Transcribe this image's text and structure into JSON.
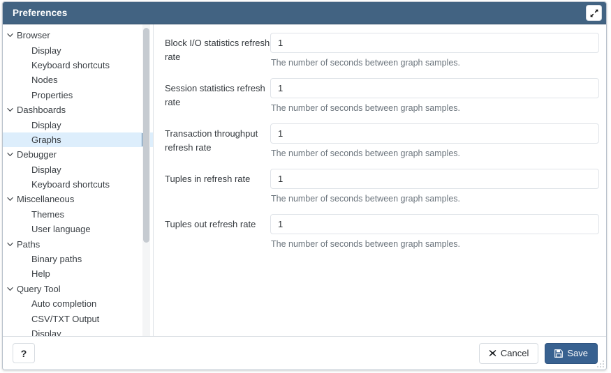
{
  "window": {
    "title": "Preferences",
    "maximize_icon": "expand-diagonal-icon",
    "accent_color": "#426382",
    "selected_row_bg": "#ddeefc",
    "selected_row_marker": "#2c5f8f"
  },
  "sidebar": {
    "items": [
      {
        "label": "Browser",
        "level": "group",
        "expanded": true,
        "icon": "chevron-down-icon",
        "selected": false
      },
      {
        "label": "Display",
        "level": "child",
        "expanded": null,
        "icon": "",
        "selected": false
      },
      {
        "label": "Keyboard shortcuts",
        "level": "child",
        "expanded": null,
        "icon": "",
        "selected": false
      },
      {
        "label": "Nodes",
        "level": "child",
        "expanded": null,
        "icon": "",
        "selected": false
      },
      {
        "label": "Properties",
        "level": "child",
        "expanded": null,
        "icon": "",
        "selected": false
      },
      {
        "label": "Dashboards",
        "level": "group",
        "expanded": true,
        "icon": "chevron-down-icon",
        "selected": false
      },
      {
        "label": "Display",
        "level": "child",
        "expanded": null,
        "icon": "",
        "selected": false
      },
      {
        "label": "Graphs",
        "level": "child",
        "expanded": null,
        "icon": "",
        "selected": true
      },
      {
        "label": "Debugger",
        "level": "group",
        "expanded": true,
        "icon": "chevron-down-icon",
        "selected": false
      },
      {
        "label": "Display",
        "level": "child",
        "expanded": null,
        "icon": "",
        "selected": false
      },
      {
        "label": "Keyboard shortcuts",
        "level": "child",
        "expanded": null,
        "icon": "",
        "selected": false
      },
      {
        "label": "Miscellaneous",
        "level": "group",
        "expanded": true,
        "icon": "chevron-down-icon",
        "selected": false
      },
      {
        "label": "Themes",
        "level": "child",
        "expanded": null,
        "icon": "",
        "selected": false
      },
      {
        "label": "User language",
        "level": "child",
        "expanded": null,
        "icon": "",
        "selected": false
      },
      {
        "label": "Paths",
        "level": "group",
        "expanded": true,
        "icon": "chevron-down-icon",
        "selected": false
      },
      {
        "label": "Binary paths",
        "level": "child",
        "expanded": null,
        "icon": "",
        "selected": false
      },
      {
        "label": "Help",
        "level": "child",
        "expanded": null,
        "icon": "",
        "selected": false
      },
      {
        "label": "Query Tool",
        "level": "group",
        "expanded": true,
        "icon": "chevron-down-icon",
        "selected": false
      },
      {
        "label": "Auto completion",
        "level": "child",
        "expanded": null,
        "icon": "",
        "selected": false
      },
      {
        "label": "CSV/TXT Output",
        "level": "child",
        "expanded": null,
        "icon": "",
        "selected": false
      },
      {
        "label": "Display",
        "level": "child",
        "expanded": null,
        "icon": "",
        "selected": false
      }
    ]
  },
  "main": {
    "fields": [
      {
        "label": "Block I/O statistics refresh rate",
        "value": "1",
        "placeholder": "",
        "help": "The number of seconds between graph samples."
      },
      {
        "label": "Session statistics refresh rate",
        "value": "1",
        "placeholder": "",
        "help": "The number of seconds between graph samples."
      },
      {
        "label": "Transaction throughput refresh rate",
        "value": "1",
        "placeholder": "",
        "help": "The number of seconds between graph samples."
      },
      {
        "label": "Tuples in refresh rate",
        "value": "1",
        "placeholder": "",
        "help": "The number of seconds between graph samples."
      },
      {
        "label": "Tuples out refresh rate",
        "value": "1",
        "placeholder": "",
        "help": "The number of seconds between graph samples."
      }
    ]
  },
  "footer": {
    "help_label": "?",
    "help_icon": "question-mark-icon",
    "cancel_label": "Cancel",
    "cancel_icon": "cross-icon",
    "save_label": "Save",
    "save_icon": "floppy-disk-icon",
    "save_bg": "#386190"
  }
}
